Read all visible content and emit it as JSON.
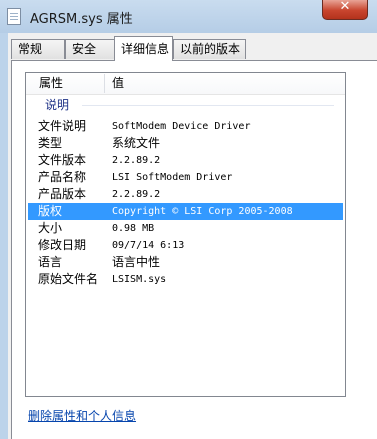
{
  "window": {
    "title": "AGRSM.sys 属性",
    "close_label": "✕"
  },
  "tabs": [
    {
      "label": "常规",
      "active": false
    },
    {
      "label": "安全",
      "active": false
    },
    {
      "label": "详细信息",
      "active": true
    },
    {
      "label": "以前的版本",
      "active": false
    }
  ],
  "details": {
    "header_property": "属性",
    "header_value": "值",
    "group_label": "说明",
    "rows": [
      {
        "property": "文件说明",
        "value": "SoftModem Device Driver",
        "selected": false
      },
      {
        "property": "类型",
        "value": "系统文件",
        "selected": false
      },
      {
        "property": "文件版本",
        "value": "2.2.89.2",
        "selected": false
      },
      {
        "property": "产品名称",
        "value": "LSI SoftModem Driver",
        "selected": false
      },
      {
        "property": "产品版本",
        "value": "2.2.89.2",
        "selected": false
      },
      {
        "property": "版权",
        "value": "Copyright © LSI Corp 2005-2008",
        "selected": true
      },
      {
        "property": "大小",
        "value": "0.98 MB",
        "selected": false
      },
      {
        "property": "修改日期",
        "value": "09/7/14 6:13",
        "selected": false
      },
      {
        "property": "语言",
        "value": "语言中性",
        "selected": false
      },
      {
        "property": "原始文件名",
        "value": "LSISM.sys",
        "selected": false
      }
    ]
  },
  "link": {
    "label": "删除属性和个人信息"
  },
  "colors": {
    "selection": "#3399ff",
    "titlebar": "#bcd3ea",
    "link": "#0645ad"
  }
}
